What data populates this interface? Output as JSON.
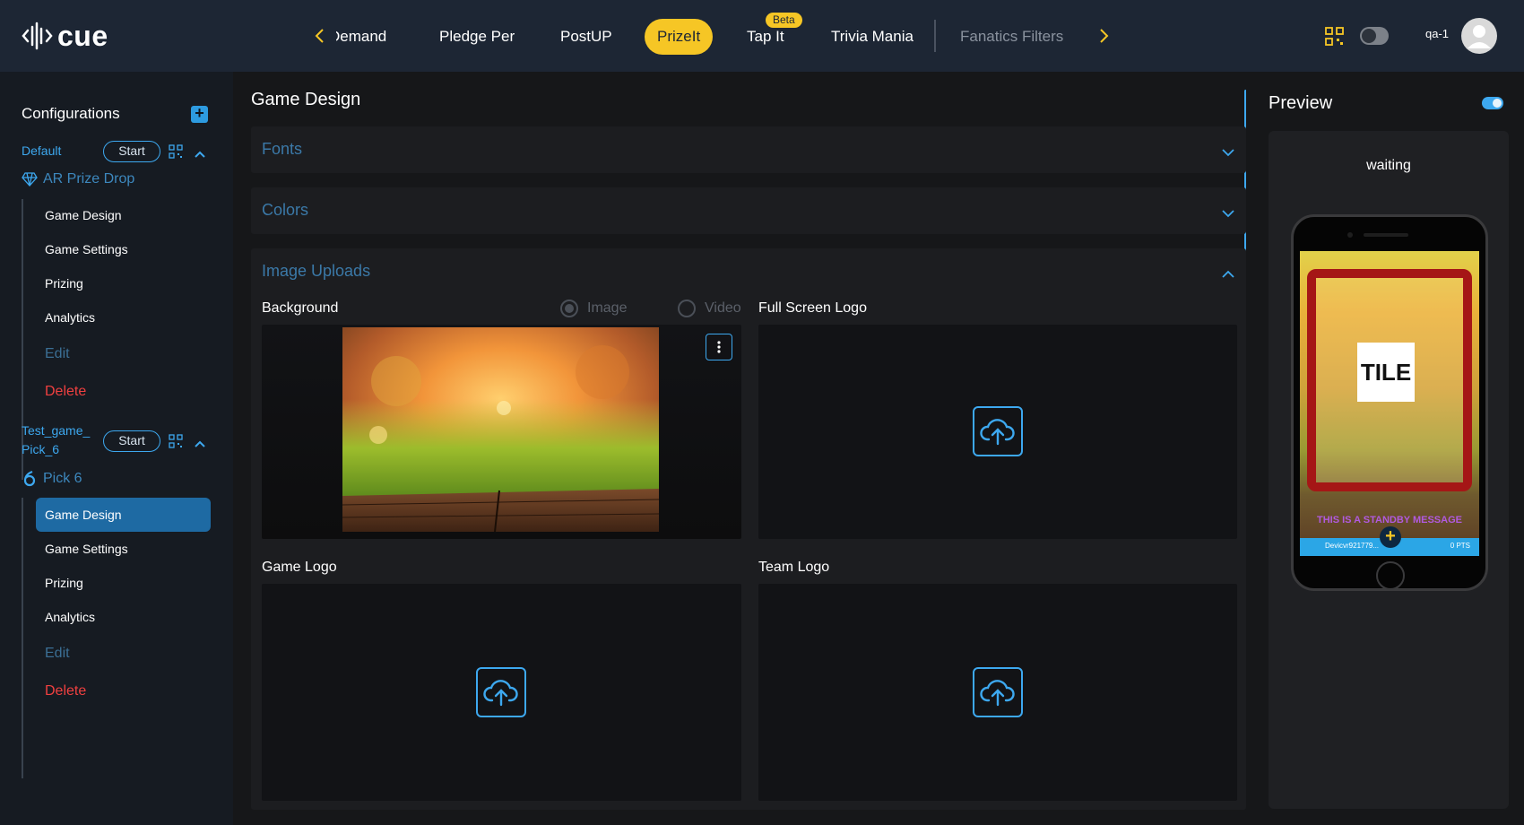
{
  "app": {
    "logo_text": "cue",
    "colors": {
      "accent": "#3da8ef",
      "active_tab": "#f6c625",
      "topbar": "#1d2634",
      "danger": "#f04040"
    }
  },
  "nav": {
    "tabs": [
      {
        "label": "Demand",
        "state": "partial"
      },
      {
        "label": "Pledge Per"
      },
      {
        "label": "PostUP"
      },
      {
        "label": "PrizeIt",
        "state": "active"
      },
      {
        "label": "Tap It",
        "badge": "Beta"
      },
      {
        "label": "Trivia Mania"
      },
      {
        "label": "Fanatics Filters",
        "state": "dim"
      }
    ],
    "prev_icon": "chevron-left-icon",
    "next_icon": "chevron-right-icon"
  },
  "user": {
    "name": "qa-1",
    "icons": [
      "qr-code-icon",
      "theme-toggle-icon",
      "avatar-icon"
    ]
  },
  "sidebar": {
    "title": "Configurations",
    "add_icon": "plus-icon",
    "configs": [
      {
        "name": "Default",
        "start_label": "Start",
        "game": "AR Prize Drop",
        "game_icon": "gem-icon",
        "items": [
          "Game Design",
          "Game Settings",
          "Prizing",
          "Analytics",
          "Edit",
          "Delete"
        ]
      },
      {
        "name_line1": "Test_game_",
        "name_line2": "Pick_6",
        "start_label": "Start",
        "game": "Pick 6",
        "game_icon": "six-icon",
        "items": [
          "Game Design",
          "Game Settings",
          "Prizing",
          "Analytics",
          "Edit",
          "Delete"
        ],
        "active_item": "Game Design"
      }
    ]
  },
  "main": {
    "title": "Game Design",
    "sections": [
      {
        "title": "Fonts",
        "expanded": false
      },
      {
        "title": "Colors",
        "expanded": false
      },
      {
        "title": "Image Uploads",
        "expanded": true
      }
    ],
    "uploads": {
      "background": {
        "label": "Background",
        "radio_image": "Image",
        "radio_video": "Video",
        "selected": "Image"
      },
      "full_screen_logo": {
        "label": "Full Screen Logo"
      },
      "game_logo": {
        "label": "Game Logo"
      },
      "team_logo": {
        "label": "Team Logo"
      }
    }
  },
  "preview": {
    "title": "Preview",
    "status": "waiting",
    "tile_text": "TILE",
    "standby_text": "THIS IS A STANDBY MESSAGE",
    "bar_user": "Devicvr921779...",
    "bar_points": "0 PTS"
  }
}
